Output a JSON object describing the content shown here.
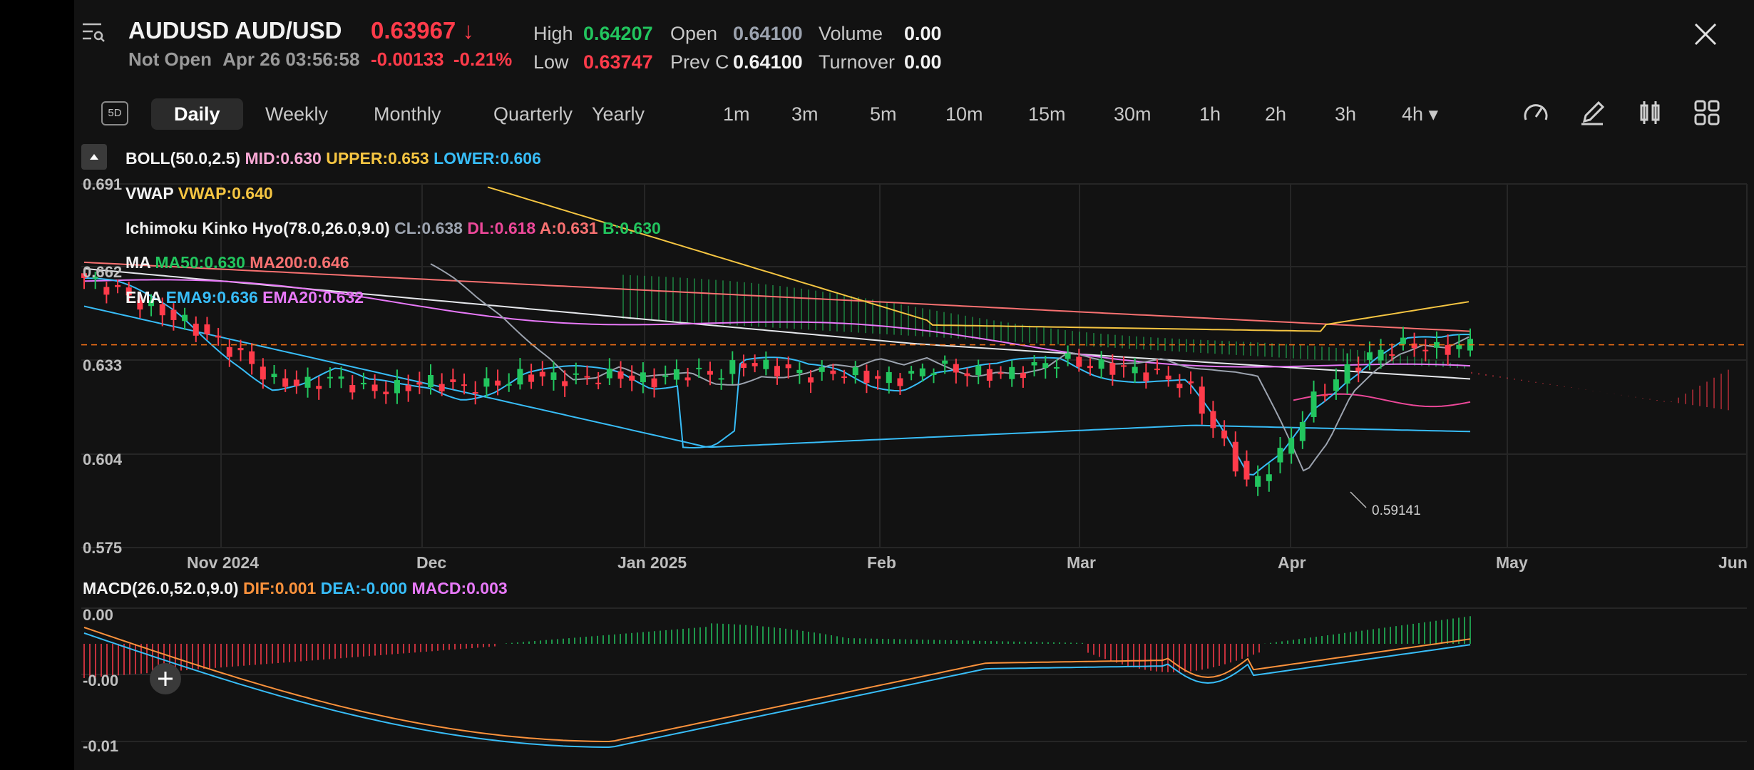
{
  "header": {
    "symbol": "AUDUSD",
    "pair": "AUD/USD",
    "price": "0.63967",
    "direction_arrow": "↓",
    "status": "Not Open",
    "timestamp": "Apr 26 03:56:58",
    "change": "-0.00133",
    "change_pct": "-0.21%",
    "stats": {
      "high_label": "High",
      "high": "0.64207",
      "low_label": "Low",
      "low": "0.63747",
      "open_label": "Open",
      "open": "0.64100",
      "prevc_label": "Prev C",
      "prevc": "0.64100",
      "volume_label": "Volume",
      "volume": "0.00",
      "turnover_label": "Turnover",
      "turnover": "0.00"
    }
  },
  "timeframes": {
    "badge": "5D",
    "items": [
      "Daily",
      "Weekly",
      "Monthly",
      "Quarterly",
      "Yearly",
      "1m",
      "3m",
      "5m",
      "10m",
      "15m",
      "30m",
      "1h",
      "2h",
      "3h",
      "4h"
    ],
    "active": "Daily"
  },
  "indicators": {
    "boll": {
      "name": "BOLL(50.0,2.5)",
      "mid": "MID:0.630",
      "upper": "UPPER:0.653",
      "lower": "LOWER:0.606"
    },
    "vwap": {
      "name": "VWAP",
      "value": "VWAP:0.640"
    },
    "ichimoku": {
      "name": "Ichimoku Kinko Hyo(78.0,26.0,9.0)",
      "cl": "CL:0.638",
      "dl": "DL:0.618",
      "a": "A:0.631",
      "b": "B:0.630"
    },
    "ma": {
      "name": "MA",
      "ma50": "MA50:0.630",
      "ma200": "MA200:0.646"
    },
    "ema": {
      "name": "EMA",
      "ema9": "EMA9:0.636",
      "ema20": "EMA20:0.632"
    },
    "macd": {
      "name": "MACD(26.0,52.0,9.0)",
      "dif": "DIF:0.001",
      "dea": "DEA:-0.000",
      "macd": "MACD:0.003"
    }
  },
  "colors": {
    "up": "#22c55e",
    "down": "#ff3b4a",
    "boll_mid": "#f9a8d4",
    "boll_upper": "#f5c542",
    "boll_lower": "#38bdf8",
    "vwap": "#f5c542",
    "cl": "#9ca3af",
    "dl": "#ec4899",
    "ma50": "#22c55e",
    "ma200": "#f87171",
    "ema9": "#38bdf8",
    "ema20": "#e879f9",
    "dif": "#fb923c",
    "dea": "#38bdf8",
    "macd": "#e879f9"
  },
  "chart_data": [
    {
      "type": "candlestick",
      "x_ticks": [
        "Nov 2024",
        "Dec",
        "Jan 2025",
        "Feb",
        "Mar",
        "Apr",
        "May",
        "Jun"
      ],
      "y_ticks": [
        "0.691",
        "0.662",
        "0.633",
        "0.604",
        "0.575"
      ],
      "ylim": [
        0.575,
        0.691
      ],
      "annotations": [
        "0.59141"
      ],
      "current_price": 0.63967,
      "close_path": [
        0.661,
        0.657,
        0.652,
        0.648,
        0.642,
        0.636,
        0.628,
        0.627,
        0.629,
        0.625,
        0.626,
        0.628,
        0.626,
        0.627,
        0.63,
        0.629,
        0.629,
        0.63,
        0.628,
        0.631,
        0.63,
        0.634,
        0.632,
        0.63,
        0.631,
        0.629,
        0.629,
        0.633,
        0.631,
        0.63,
        0.632,
        0.635,
        0.633,
        0.632,
        0.63,
        0.627,
        0.611,
        0.594,
        0.605,
        0.622,
        0.631,
        0.637,
        0.64,
        0.638,
        0.64
      ]
    },
    {
      "type": "line",
      "title": "MACD(26.0,52.0,9.0)",
      "y_ticks": [
        "0.00",
        "-0.00",
        "-0.01"
      ]
    }
  ]
}
